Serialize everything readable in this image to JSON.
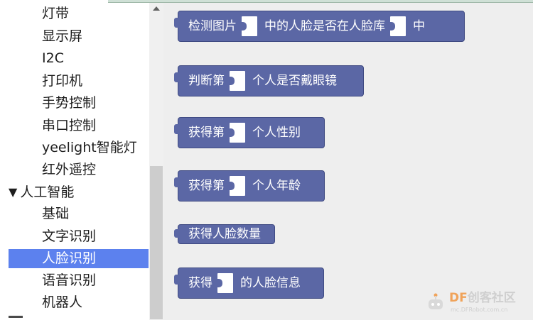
{
  "sidebar": {
    "items": [
      {
        "label": "灯带"
      },
      {
        "label": "显示屏"
      },
      {
        "label": "I2C"
      },
      {
        "label": "打印机"
      },
      {
        "label": "手势控制"
      },
      {
        "label": "串口控制"
      },
      {
        "label": "yeelight智能灯"
      },
      {
        "label": "红外遥控"
      },
      {
        "label": "人工智能"
      },
      {
        "label": "基础"
      },
      {
        "label": "文字识别"
      },
      {
        "label": "人脸识别"
      },
      {
        "label": "语音识别"
      },
      {
        "label": "机器人"
      }
    ],
    "expanded_marker": "▼",
    "selected": "人脸识别",
    "selected_color": "#5c81ee"
  },
  "blocks": [
    {
      "parts": [
        "检测图片",
        "中的人脸是否在人脸库",
        "中"
      ]
    },
    {
      "parts": [
        "判断第",
        "个人是否戴眼镜"
      ]
    },
    {
      "parts": [
        "获得第",
        "个人性别"
      ]
    },
    {
      "parts": [
        "获得第",
        "个人年龄"
      ]
    },
    {
      "parts": [
        "获得人脸数量"
      ]
    },
    {
      "parts": [
        "获得",
        "的人脸信息"
      ]
    }
  ],
  "block_color": "#5b67a5",
  "watermark": {
    "brand": "DF",
    "site": "创客社区",
    "url": "mc.DFRobot.com.cn",
    "brand_color": "#f0a35a"
  }
}
